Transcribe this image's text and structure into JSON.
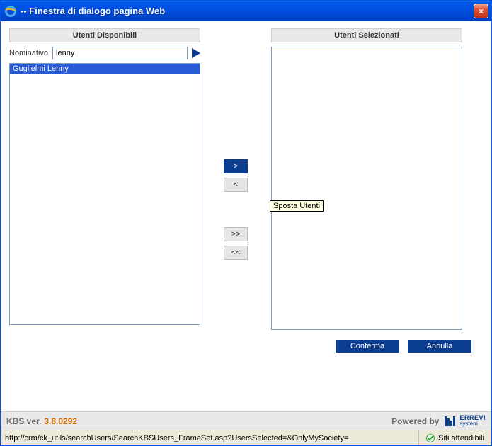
{
  "window": {
    "title": "-- Finestra di dialogo pagina Web",
    "close_glyph": "×"
  },
  "left": {
    "header": "Utenti Disponibili",
    "search_label": "Nominativo",
    "search_value": "lenny",
    "items": [
      "Guglielmi Lenny"
    ]
  },
  "right": {
    "header": "Utenti Selezionati"
  },
  "mid": {
    "move_right": ">",
    "move_left": "<",
    "move_all_right": ">>",
    "move_all_left": "<<",
    "tooltip": "Sposta Utenti"
  },
  "actions": {
    "confirm": "Conferma",
    "cancel": "Annulla"
  },
  "footer": {
    "product": "KBS ver.",
    "version": "3.8.0292",
    "powered": "Powered by",
    "brand_top": "ERREVI",
    "brand_bottom": "system"
  },
  "status": {
    "url": "http://crm/ck_utils/searchUsers/SearchKBSUsers_FrameSet.asp?UsersSelected=&OnlyMySociety=",
    "zone": "Siti attendibili"
  }
}
